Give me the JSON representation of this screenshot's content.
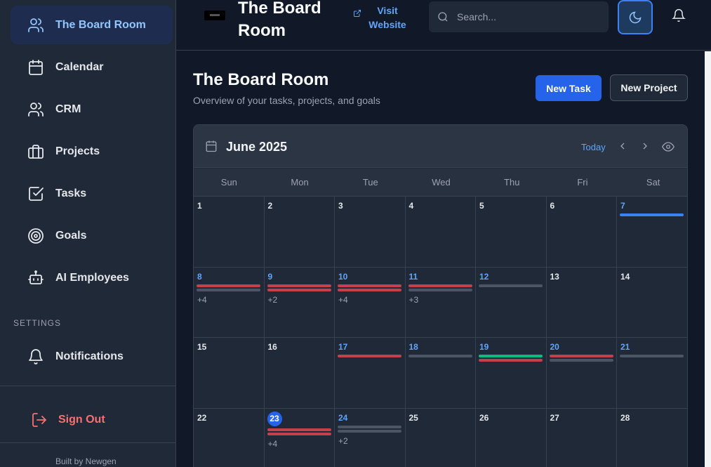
{
  "sidebar": {
    "items": [
      {
        "label": "The Board Room",
        "icon": "users-icon"
      },
      {
        "label": "Calendar",
        "icon": "calendar-icon"
      },
      {
        "label": "CRM",
        "icon": "contacts-icon"
      },
      {
        "label": "Projects",
        "icon": "briefcase-icon"
      },
      {
        "label": "Tasks",
        "icon": "checkbox-icon"
      },
      {
        "label": "Goals",
        "icon": "target-icon"
      },
      {
        "label": "AI Employees",
        "icon": "bot-icon"
      }
    ],
    "settings_heading": "SETTINGS",
    "notifications_label": "Notifications",
    "sign_out_label": "Sign Out",
    "built_by": "Built by Newgen"
  },
  "header": {
    "title": "The Board Room",
    "visit_label": "Visit Website",
    "search_placeholder": "Search..."
  },
  "main": {
    "title": "The Board Room",
    "subtitle": "Overview of your tasks, projects, and goals",
    "new_task_label": "New Task",
    "new_project_label": "New Project"
  },
  "calendar": {
    "month": "June 2025",
    "today_label": "Today",
    "weekdays": [
      "Sun",
      "Mon",
      "Tue",
      "Wed",
      "Thu",
      "Fri",
      "Sat"
    ],
    "weeks": [
      [
        {
          "day": "1"
        },
        {
          "day": "2"
        },
        {
          "day": "3"
        },
        {
          "day": "4"
        },
        {
          "day": "5"
        },
        {
          "day": "6"
        },
        {
          "day": "7",
          "highlight": true,
          "bars": [
            "blue"
          ]
        }
      ],
      [
        {
          "day": "8",
          "highlight": true,
          "bars": [
            "red",
            "gray"
          ],
          "more": "+4"
        },
        {
          "day": "9",
          "highlight": true,
          "bars": [
            "red",
            "red"
          ],
          "more": "+2"
        },
        {
          "day": "10",
          "highlight": true,
          "bars": [
            "red",
            "red"
          ],
          "more": "+4"
        },
        {
          "day": "11",
          "highlight": true,
          "bars": [
            "red",
            "gray"
          ],
          "more": "+3"
        },
        {
          "day": "12",
          "highlight": true,
          "bars": [
            "gray"
          ]
        },
        {
          "day": "13"
        },
        {
          "day": "14"
        }
      ],
      [
        {
          "day": "15"
        },
        {
          "day": "16"
        },
        {
          "day": "17",
          "highlight": true,
          "bars": [
            "red"
          ]
        },
        {
          "day": "18",
          "highlight": true,
          "bars": [
            "gray"
          ]
        },
        {
          "day": "19",
          "highlight": true,
          "bars": [
            "green",
            "red"
          ]
        },
        {
          "day": "20",
          "highlight": true,
          "bars": [
            "red",
            "gray"
          ]
        },
        {
          "day": "21",
          "highlight": true,
          "bars": [
            "gray"
          ]
        }
      ],
      [
        {
          "day": "22"
        },
        {
          "day": "23",
          "today": true,
          "bars": [
            "red",
            "red"
          ],
          "more": "+4"
        },
        {
          "day": "24",
          "highlight": true,
          "bars": [
            "gray",
            "gray"
          ],
          "more": "+2"
        },
        {
          "day": "25"
        },
        {
          "day": "26"
        },
        {
          "day": "27"
        },
        {
          "day": "28"
        }
      ]
    ]
  },
  "colors": {
    "red": "#c2414a",
    "gray": "#4b5563",
    "blue": "#3b82f6",
    "green": "#10b981",
    "accent": "#2563eb"
  }
}
